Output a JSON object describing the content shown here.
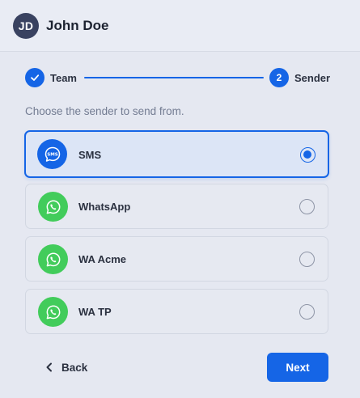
{
  "user": {
    "initials": "JD",
    "name": "John Doe"
  },
  "stepper": {
    "steps": [
      {
        "label": "Team",
        "status": "completed",
        "icon": "check-icon"
      },
      {
        "label": "Sender",
        "number": "2",
        "status": "active"
      }
    ]
  },
  "instruction": "Choose the sender to send from.",
  "options": [
    {
      "label": "SMS",
      "icon": "sms-bubble-icon",
      "selected": true
    },
    {
      "label": "WhatsApp",
      "icon": "whatsapp-icon",
      "selected": false
    },
    {
      "label": "WA Acme",
      "icon": "whatsapp-icon",
      "selected": false
    },
    {
      "label": "WA TP",
      "icon": "whatsapp-icon",
      "selected": false
    }
  ],
  "footer": {
    "back_label": "Back",
    "next_label": "Next"
  },
  "colors": {
    "accent": "#1565e6",
    "whatsapp": "#42cc5b",
    "avatar": "#394260"
  }
}
